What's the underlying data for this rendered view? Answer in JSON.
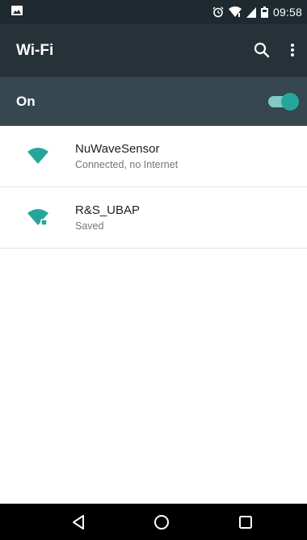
{
  "status_bar": {
    "time": "09:58",
    "icons": [
      "image-notification-icon",
      "alarm-icon",
      "wifi-signal-icon",
      "cell-signal-icon",
      "battery-icon"
    ]
  },
  "toolbar": {
    "title": "Wi-Fi",
    "search_icon": "search-icon",
    "overflow_icon": "more-vert-icon"
  },
  "master_switch": {
    "label": "On",
    "state": "on",
    "accent_color": "#26a69a"
  },
  "networks": [
    {
      "name": "NuWaveSensor",
      "status": "Connected, no Internet",
      "icon": "wifi-full-icon"
    },
    {
      "name": "R&S_UBAP",
      "status": "Saved",
      "icon": "wifi-secured-icon"
    }
  ],
  "nav_bar": {
    "buttons": [
      "back-icon",
      "home-icon",
      "recents-icon"
    ]
  },
  "colors": {
    "status_bar": "#1f2a30",
    "toolbar": "#263238",
    "master_bar": "#37474f",
    "accent": "#26a69a"
  }
}
